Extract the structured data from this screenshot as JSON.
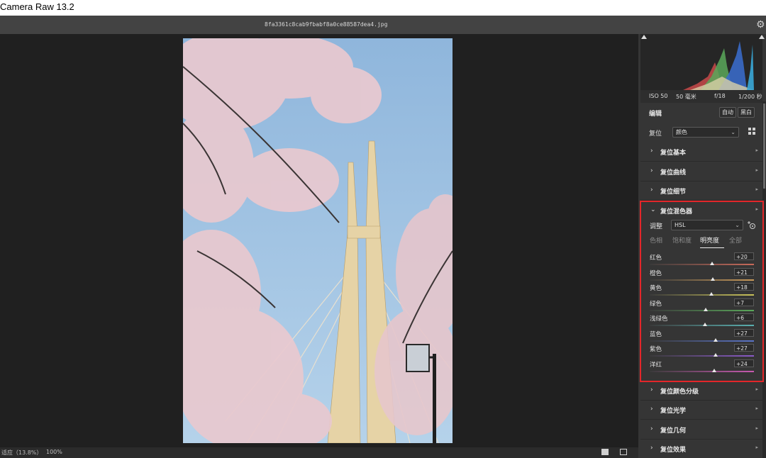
{
  "app": {
    "title": "Camera Raw 13.2"
  },
  "file": {
    "name": "8fa3361c8cab9fbabf8a0ce88587dea4.jpg"
  },
  "status": {
    "fit_label": "适应（13.8%）",
    "zoom": "100%"
  },
  "exif": {
    "iso": "ISO 50",
    "focal": "50 毫米",
    "aperture": "f/18",
    "shutter": "1/200 秒"
  },
  "edit": {
    "title": "编辑",
    "auto": "自动",
    "bw": "黑白"
  },
  "profile": {
    "label": "复位",
    "value": "颜色"
  },
  "sections": {
    "basic": "复位基本",
    "curve": "复位曲线",
    "detail": "复位细节",
    "mixer": "复位混色器",
    "grading": "复位颜色分级",
    "optics": "复位光学",
    "geometry": "复位几何",
    "effects": "复位效果"
  },
  "mixer": {
    "adjust_label": "调整",
    "adjust_value": "HSL",
    "tabs": [
      "色相",
      "饱和度",
      "明亮度",
      "全部"
    ],
    "active_tab": "明亮度",
    "sliders": [
      {
        "name": "红色",
        "value": "+20",
        "level": 0.6,
        "color": "#c86a5a"
      },
      {
        "name": "橙色",
        "value": "+21",
        "level": 0.605,
        "color": "#c99a5a"
      },
      {
        "name": "黄色",
        "value": "+18",
        "level": 0.59,
        "color": "#c9c25a"
      },
      {
        "name": "绿色",
        "value": "+7",
        "level": 0.535,
        "color": "#5aa85a"
      },
      {
        "name": "浅绿色",
        "value": "+6",
        "level": 0.53,
        "color": "#5ab0b0"
      },
      {
        "name": "蓝色",
        "value": "+27",
        "level": 0.635,
        "color": "#5a74c8"
      },
      {
        "name": "紫色",
        "value": "+27",
        "level": 0.635,
        "color": "#8a5ac8"
      },
      {
        "name": "洋红",
        "value": "+24",
        "level": 0.62,
        "color": "#c85ab0"
      }
    ]
  }
}
